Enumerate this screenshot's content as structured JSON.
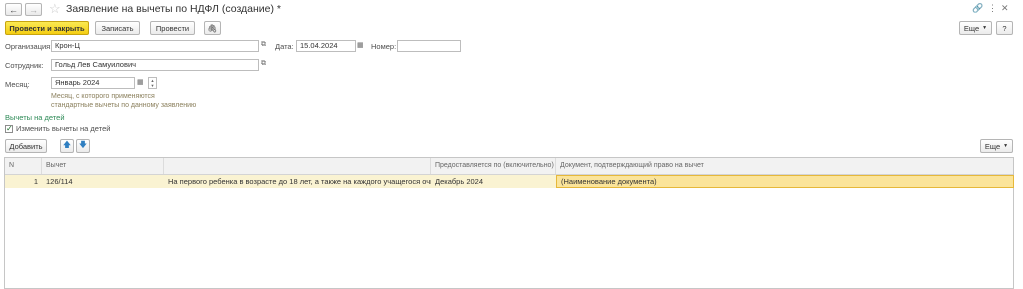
{
  "window": {
    "title": "Заявление на вычеты по НДФЛ (создание) *"
  },
  "toolbar": {
    "post_close_label": "Провести и закрыть",
    "save_label": "Записать",
    "post_label": "Провести",
    "more_label": "Еще",
    "help_label": "?"
  },
  "form": {
    "org_label": "Организация:",
    "org_value": "Крон-Ц",
    "date_label": "Дата:",
    "date_value": "15.04.2024",
    "number_label": "Номер:",
    "number_value": "",
    "employee_label": "Сотрудник:",
    "employee_value": "Гольд Лев Самуилович",
    "month_label": "Месяц:",
    "month_value": "Январь 2024",
    "month_hint_line1": "Месяц, с которого применяются",
    "month_hint_line2": "стандартные вычеты по данному заявлению"
  },
  "section": {
    "title": "Вычеты на детей",
    "checkbox_label": "Изменить вычеты на детей",
    "checkbox_checked": true
  },
  "table_toolbar": {
    "add_label": "Добавить",
    "more_label": "Еще"
  },
  "table": {
    "columns": [
      "N",
      "Вычет",
      "",
      "Предоставляется по (включительно)",
      "Документ, подтверждающий право на вычет"
    ],
    "rows": [
      {
        "n": "1",
        "code": "126/114",
        "description": "На первого ребенка в возрасте до 18 лет, а также на каждого учащегося очн...",
        "until": "Декабрь 2024",
        "document": "(Наименование документа)"
      }
    ]
  }
}
